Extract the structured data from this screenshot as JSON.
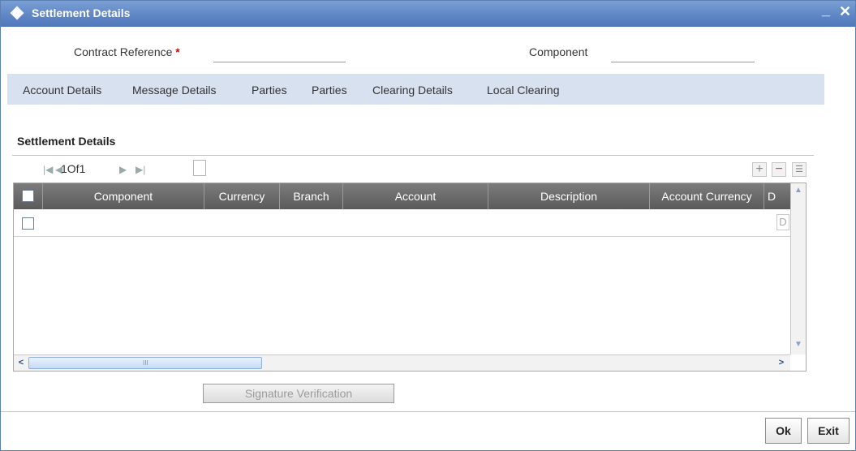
{
  "window": {
    "title": "Settlement Details",
    "minimize_glyph": "_",
    "close_glyph": "✕"
  },
  "fields": {
    "contract_reference_label": "Contract Reference",
    "required_marker": "*",
    "contract_reference_value": "",
    "component_label": "Component",
    "component_value": ""
  },
  "tabs": [
    {
      "label": "Account Details"
    },
    {
      "label": "Message Details"
    },
    {
      "label": "Parties"
    },
    {
      "label": "Parties"
    },
    {
      "label": "Clearing Details"
    },
    {
      "label": "Local Clearing"
    }
  ],
  "section": {
    "title": "Settlement Details"
  },
  "pagination": {
    "text": "1Of1"
  },
  "grid": {
    "columns": [
      {
        "label": "Component"
      },
      {
        "label": "Currency"
      },
      {
        "label": "Branch"
      },
      {
        "label": "Account"
      },
      {
        "label": "Description"
      },
      {
        "label": "Account Currency"
      },
      {
        "label": "D"
      }
    ],
    "row_cut_cell": "D",
    "scroll_marker": "III"
  },
  "buttons": {
    "signature_verification": "Signature Verification",
    "ok": "Ok",
    "exit": "Exit"
  },
  "colors": {
    "titlebar": "#5e85c4",
    "tab_strip": "#d8e1ef",
    "grid_header": "#6a6a6a",
    "required": "#dd0000"
  }
}
